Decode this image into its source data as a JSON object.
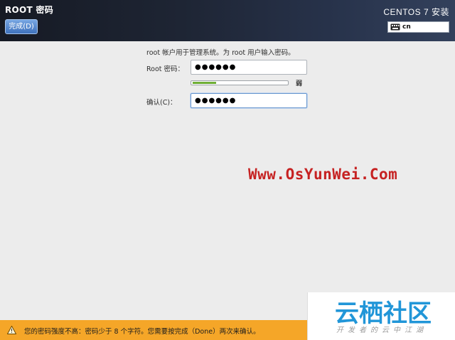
{
  "header": {
    "title": "ROOT 密码",
    "done_button": "完成(D)",
    "product": "CENTOS 7 安装",
    "keyboard": {
      "icon": "keyboard-icon",
      "layout": "cn"
    }
  },
  "form": {
    "instruction": "root 帐户用于管理系统。为 root 用户输入密码。",
    "password_label": "Root 密码：",
    "password_value": "●●●●●●",
    "confirm_label": "确认(C)：",
    "confirm_value": "●●●●●●",
    "strength": {
      "fraction": 0.25,
      "label": "弱",
      "color": "#6fae35"
    }
  },
  "watermark": "Www.OsYunWei.Com",
  "warning": {
    "icon": "warning-icon",
    "text": "您的密码强度不高：密码少于 8 个字符。您需要按完成（Done）两次来确认。"
  },
  "logo": {
    "main": "云栖社区",
    "sub": "开发者的云中江湖"
  }
}
